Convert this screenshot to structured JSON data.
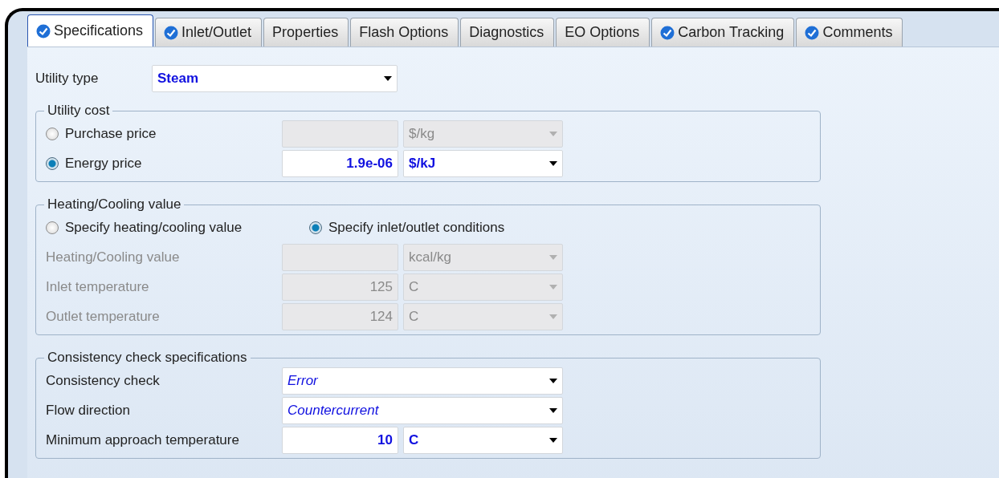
{
  "tabs": [
    {
      "label": "Specifications",
      "complete": true,
      "selected": true
    },
    {
      "label": "Inlet/Outlet",
      "complete": true,
      "selected": false
    },
    {
      "label": "Properties",
      "complete": false,
      "selected": false
    },
    {
      "label": "Flash Options",
      "complete": false,
      "selected": false
    },
    {
      "label": "Diagnostics",
      "complete": false,
      "selected": false
    },
    {
      "label": "EO Options",
      "complete": false,
      "selected": false
    },
    {
      "label": "Carbon Tracking",
      "complete": true,
      "selected": false
    },
    {
      "label": "Comments",
      "complete": true,
      "selected": false
    }
  ],
  "utility_type": {
    "label": "Utility type",
    "value": "Steam",
    "entered": true
  },
  "utility_cost": {
    "title": "Utility cost",
    "options": [
      {
        "label": "Purchase price",
        "selected": false,
        "disabled": true,
        "unit": "$/kg",
        "entered": false
      },
      {
        "label": "Energy price",
        "selected": true,
        "disabled": false,
        "value": "1.9e-06",
        "unit": "$/kJ",
        "entered": true
      }
    ]
  },
  "heating_cooling": {
    "title": "Heating/Cooling value",
    "options": [
      {
        "label": "Specify heating/cooling value",
        "selected": false
      },
      {
        "label": "Specify inlet/outlet conditions",
        "selected": true
      }
    ],
    "rows": [
      {
        "label": "Heating/Cooling value",
        "disabled": true,
        "unit": "kcal/kg"
      },
      {
        "label": "Inlet temperature",
        "disabled": true,
        "value": "125",
        "unit": "C"
      },
      {
        "label": "Outlet temperature",
        "disabled": true,
        "value": "124",
        "unit": "C"
      }
    ]
  },
  "consistency": {
    "title": "Consistency check specifications",
    "rows": [
      {
        "kind": "select",
        "label": "Consistency check",
        "value": "Error",
        "entered": false
      },
      {
        "kind": "select",
        "label": "Flow direction",
        "value": "Countercurrent",
        "entered": false
      },
      {
        "kind": "quantity",
        "label": "Minimum approach temperature",
        "value": "10",
        "unit": "C",
        "entered": true
      }
    ]
  }
}
